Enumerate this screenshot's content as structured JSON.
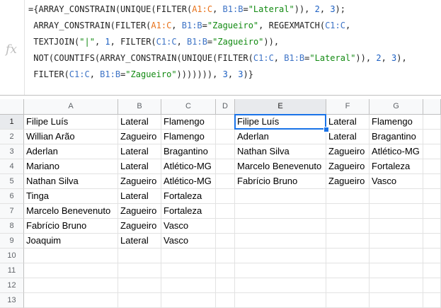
{
  "formula": {
    "fx_label": "fx",
    "lines": [
      [
        {
          "t": "={ARRAY_CONSTRAIN(UNIQUE(FILTER(",
          "c": ""
        },
        {
          "t": "A1:C",
          "c": "rng-orange"
        },
        {
          "t": ", ",
          "c": ""
        },
        {
          "t": "B1:B",
          "c": "rng-blue"
        },
        {
          "t": "=",
          "c": ""
        },
        {
          "t": "\"Lateral\"",
          "c": "str"
        },
        {
          "t": ")), ",
          "c": ""
        },
        {
          "t": "2",
          "c": "num"
        },
        {
          "t": ", ",
          "c": ""
        },
        {
          "t": "3",
          "c": "num"
        },
        {
          "t": ");",
          "c": ""
        }
      ],
      [
        {
          "t": " ARRAY_CONSTRAIN(FILTER(",
          "c": ""
        },
        {
          "t": "A1:C",
          "c": "rng-orange"
        },
        {
          "t": ", ",
          "c": ""
        },
        {
          "t": "B1:B",
          "c": "rng-blue"
        },
        {
          "t": "=",
          "c": ""
        },
        {
          "t": "\"Zagueiro\"",
          "c": "str"
        },
        {
          "t": ", REGEXMATCH(",
          "c": ""
        },
        {
          "t": "C1:C",
          "c": "rng-blue"
        },
        {
          "t": ",",
          "c": ""
        }
      ],
      [
        {
          "t": " TEXTJOIN(",
          "c": ""
        },
        {
          "t": "\"|\"",
          "c": "str"
        },
        {
          "t": ", ",
          "c": ""
        },
        {
          "t": "1",
          "c": "num"
        },
        {
          "t": ", FILTER(",
          "c": ""
        },
        {
          "t": "C1:C",
          "c": "rng-blue"
        },
        {
          "t": ", ",
          "c": ""
        },
        {
          "t": "B1:B",
          "c": "rng-blue"
        },
        {
          "t": "=",
          "c": ""
        },
        {
          "t": "\"Zagueiro\"",
          "c": "str"
        },
        {
          "t": ")),",
          "c": ""
        }
      ],
      [
        {
          "t": " NOT(COUNTIFS(ARRAY_CONSTRAIN(UNIQUE(FILTER(",
          "c": ""
        },
        {
          "t": "C1:C",
          "c": "rng-blue"
        },
        {
          "t": ", ",
          "c": ""
        },
        {
          "t": "B1:B",
          "c": "rng-blue"
        },
        {
          "t": "=",
          "c": ""
        },
        {
          "t": "\"Lateral\"",
          "c": "str"
        },
        {
          "t": ")), ",
          "c": ""
        },
        {
          "t": "2",
          "c": "num"
        },
        {
          "t": ", ",
          "c": ""
        },
        {
          "t": "3",
          "c": "num"
        },
        {
          "t": "),",
          "c": ""
        }
      ],
      [
        {
          "t": " FILTER(",
          "c": ""
        },
        {
          "t": "C1:C",
          "c": "rng-blue"
        },
        {
          "t": ", ",
          "c": ""
        },
        {
          "t": "B1:B",
          "c": "rng-blue"
        },
        {
          "t": "=",
          "c": ""
        },
        {
          "t": "\"Zagueiro\"",
          "c": "str"
        },
        {
          "t": "))))))), ",
          "c": ""
        },
        {
          "t": "3",
          "c": "num"
        },
        {
          "t": ", ",
          "c": ""
        },
        {
          "t": "3",
          "c": "num"
        },
        {
          "t": ")}",
          "c": ""
        }
      ]
    ]
  },
  "grid": {
    "columns": [
      "A",
      "B",
      "C",
      "D",
      "E",
      "F",
      "G"
    ],
    "active_column": "E",
    "row_numbers": [
      "1",
      "2",
      "3",
      "4",
      "5",
      "6",
      "7",
      "8",
      "9",
      "10",
      "11",
      "12",
      "13"
    ],
    "active_row": "1",
    "rows": [
      [
        "Filipe Luís",
        "Lateral",
        "Flamengo",
        "",
        "Filipe Luís",
        "Lateral",
        "Flamengo"
      ],
      [
        "Willian Arão",
        "Zagueiro",
        "Flamengo",
        "",
        "Aderlan",
        "Lateral",
        "Bragantino"
      ],
      [
        "Aderlan",
        "Lateral",
        "Bragantino",
        "",
        "Nathan Silva",
        "Zagueiro",
        "Atlético-MG"
      ],
      [
        "Mariano",
        "Lateral",
        "Atlético-MG",
        "",
        "Marcelo Benevenuto",
        "Zagueiro",
        "Fortaleza"
      ],
      [
        "Nathan Silva",
        "Zagueiro",
        "Atlético-MG",
        "",
        "Fabrício Bruno",
        "Zagueiro",
        "Vasco"
      ],
      [
        "Tinga",
        "Lateral",
        "Fortaleza",
        "",
        "",
        "",
        ""
      ],
      [
        "Marcelo Benevenuto",
        "Zagueiro",
        "Fortaleza",
        "",
        "",
        "",
        ""
      ],
      [
        "Fabrício Bruno",
        "Zagueiro",
        "Vasco",
        "",
        "",
        "",
        ""
      ],
      [
        "Joaquim",
        "Lateral",
        "Vasco",
        "",
        "",
        "",
        ""
      ],
      [
        "",
        "",
        "",
        "",
        "",
        "",
        ""
      ],
      [
        "",
        "",
        "",
        "",
        "",
        "",
        ""
      ],
      [
        "",
        "",
        "",
        "",
        "",
        "",
        ""
      ],
      [
        "",
        "",
        "",
        "",
        "",
        "",
        ""
      ]
    ]
  }
}
